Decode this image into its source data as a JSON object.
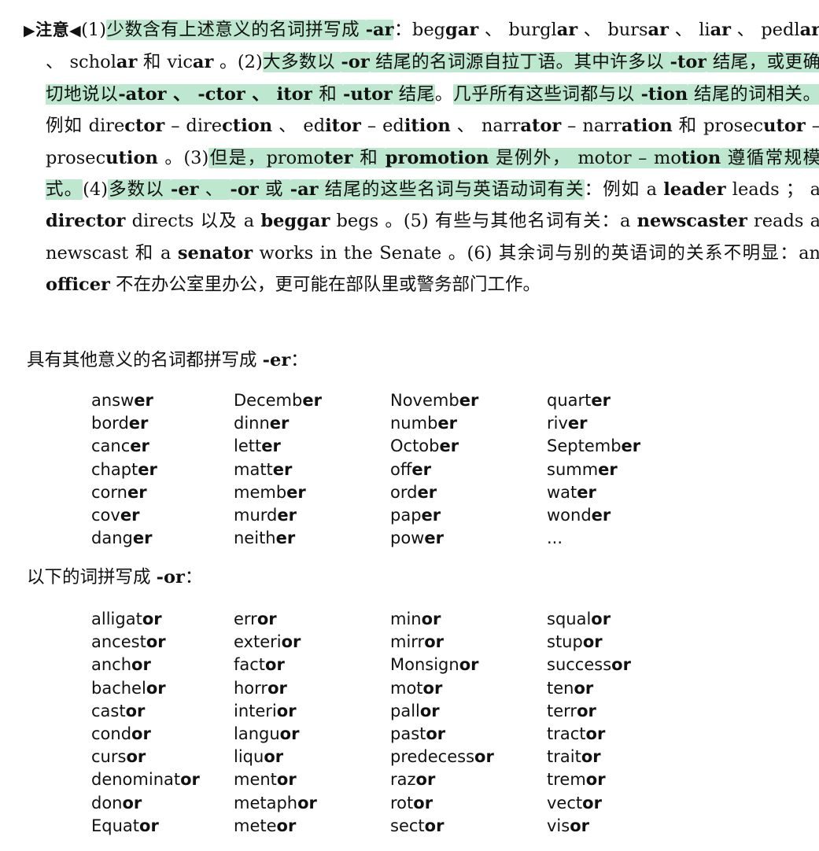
{
  "note": {
    "label": "注意",
    "segments": [
      {
        "text": "(1)",
        "hl": false,
        "bold": false
      },
      {
        "text": "少数含有上述意义的名词拼写成 ",
        "hl": true,
        "bold": false
      },
      {
        "text": "-ar",
        "hl": true,
        "bold": true
      },
      {
        "text": "：beg",
        "hl": false,
        "bold": false
      },
      {
        "text": "gar",
        "hl": false,
        "bold": true
      },
      {
        "text": " 、 burgl",
        "hl": false,
        "bold": false
      },
      {
        "text": "ar",
        "hl": false,
        "bold": true
      },
      {
        "text": " 、 burs",
        "hl": false,
        "bold": false
      },
      {
        "text": "ar",
        "hl": false,
        "bold": true
      },
      {
        "text": " 、 li",
        "hl": false,
        "bold": false
      },
      {
        "text": "ar",
        "hl": false,
        "bold": true
      },
      {
        "text": " 、 pedl",
        "hl": false,
        "bold": false
      },
      {
        "text": "ar",
        "hl": false,
        "bold": true
      },
      {
        "text": " 、 schol",
        "hl": false,
        "bold": false
      },
      {
        "text": "ar",
        "hl": false,
        "bold": true
      },
      {
        "text": " 和 vic",
        "hl": false,
        "bold": false
      },
      {
        "text": "ar",
        "hl": false,
        "bold": true
      },
      {
        "text": " 。(2)",
        "hl": false,
        "bold": false
      },
      {
        "text": "大多数以 ",
        "hl": true,
        "bold": false
      },
      {
        "text": "-or",
        "hl": true,
        "bold": true
      },
      {
        "text": " 结尾的名词源自拉丁语。其中许多以 ",
        "hl": true,
        "bold": false
      },
      {
        "text": "-tor",
        "hl": true,
        "bold": true
      },
      {
        "text": " 结尾，或更确切地说以",
        "hl": true,
        "bold": false
      },
      {
        "text": "-ator 、 -ctor 、 itor",
        "hl": true,
        "bold": true
      },
      {
        "text": " 和 ",
        "hl": true,
        "bold": false
      },
      {
        "text": "-utor",
        "hl": true,
        "bold": true
      },
      {
        "text": " 结尾",
        "hl": true,
        "bold": false
      },
      {
        "text": "。",
        "hl": false,
        "bold": false
      },
      {
        "text": "几乎所有这些词都与以 ",
        "hl": true,
        "bold": false
      },
      {
        "text": "-tion",
        "hl": true,
        "bold": true
      },
      {
        "text": " 结尾的词相关。",
        "hl": true,
        "bold": false
      },
      {
        "text": "例如 dire",
        "hl": false,
        "bold": false
      },
      {
        "text": "ctor",
        "hl": false,
        "bold": true
      },
      {
        "text": " – dire",
        "hl": false,
        "bold": false
      },
      {
        "text": "ction",
        "hl": false,
        "bold": true
      },
      {
        "text": " 、 ed",
        "hl": false,
        "bold": false
      },
      {
        "text": "itor",
        "hl": false,
        "bold": true
      },
      {
        "text": " – ed",
        "hl": false,
        "bold": false
      },
      {
        "text": "ition",
        "hl": false,
        "bold": true
      },
      {
        "text": " 、 narr",
        "hl": false,
        "bold": false
      },
      {
        "text": "ator",
        "hl": false,
        "bold": true
      },
      {
        "text": " – narr",
        "hl": false,
        "bold": false
      },
      {
        "text": "ation",
        "hl": false,
        "bold": true
      },
      {
        "text": " 和 prosec",
        "hl": false,
        "bold": false
      },
      {
        "text": "utor",
        "hl": false,
        "bold": true
      },
      {
        "text": " – prosec",
        "hl": false,
        "bold": false
      },
      {
        "text": "ution",
        "hl": false,
        "bold": true
      },
      {
        "text": " 。(3)",
        "hl": false,
        "bold": false
      },
      {
        "text": "但是，promo",
        "hl": true,
        "bold": false
      },
      {
        "text": "ter",
        "hl": true,
        "bold": true
      },
      {
        "text": " 和 ",
        "hl": true,
        "bold": false
      },
      {
        "text": "promotion",
        "hl": true,
        "bold": true
      },
      {
        "text": " 是例外， motor – mo",
        "hl": true,
        "bold": false
      },
      {
        "text": "tion",
        "hl": true,
        "bold": true
      },
      {
        "text": " 遵循常规模式。",
        "hl": true,
        "bold": false
      },
      {
        "text": "(4)",
        "hl": false,
        "bold": false
      },
      {
        "text": "多数以 ",
        "hl": true,
        "bold": false
      },
      {
        "text": "-er",
        "hl": true,
        "bold": true
      },
      {
        "text": " 、 ",
        "hl": true,
        "bold": false
      },
      {
        "text": "-or",
        "hl": true,
        "bold": true
      },
      {
        "text": " 或 ",
        "hl": true,
        "bold": false
      },
      {
        "text": "-ar",
        "hl": true,
        "bold": true
      },
      {
        "text": " 结尾的这些名词与英语动词有关",
        "hl": true,
        "bold": false
      },
      {
        "text": "：例如 a ",
        "hl": false,
        "bold": false
      },
      {
        "text": "leader",
        "hl": false,
        "bold": true
      },
      {
        "text": " leads ； a ",
        "hl": false,
        "bold": false
      },
      {
        "text": "director",
        "hl": false,
        "bold": true
      },
      {
        "text": " directs 以及 a ",
        "hl": false,
        "bold": false
      },
      {
        "text": "beggar",
        "hl": false,
        "bold": true
      },
      {
        "text": " begs 。(5) 有些与其他名词有关：a ",
        "hl": false,
        "bold": false
      },
      {
        "text": "newscaster",
        "hl": false,
        "bold": true
      },
      {
        "text": " reads a newscast 和 a ",
        "hl": false,
        "bold": false
      },
      {
        "text": "senator",
        "hl": false,
        "bold": true
      },
      {
        "text": " works in the Senate 。(6) 其余词与别的英语词的关系不明显：an ",
        "hl": false,
        "bold": false
      },
      {
        "text": "officer",
        "hl": false,
        "bold": true
      },
      {
        "text": " 不在办公室里办公，更可能在部队里或警务部门工作。",
        "hl": false,
        "bold": false
      }
    ]
  },
  "er_section": {
    "intro": "具有其他意义的名词都拼写成",
    "suffix": "-er",
    "colon": "：",
    "words": [
      [
        "answ",
        "er"
      ],
      [
        "Decemb",
        "er"
      ],
      [
        "Novemb",
        "er"
      ],
      [
        "quart",
        "er"
      ],
      [
        "bord",
        "er"
      ],
      [
        "dinn",
        "er"
      ],
      [
        "numb",
        "er"
      ],
      [
        "riv",
        "er"
      ],
      [
        "canc",
        "er"
      ],
      [
        "lett",
        "er"
      ],
      [
        "Octob",
        "er"
      ],
      [
        "Septemb",
        "er"
      ],
      [
        "chapt",
        "er"
      ],
      [
        "matt",
        "er"
      ],
      [
        "off",
        "er"
      ],
      [
        "summ",
        "er"
      ],
      [
        "corn",
        "er"
      ],
      [
        "memb",
        "er"
      ],
      [
        "ord",
        "er"
      ],
      [
        "wat",
        "er"
      ],
      [
        "cov",
        "er"
      ],
      [
        "murd",
        "er"
      ],
      [
        "pap",
        "er"
      ],
      [
        "wond",
        "er"
      ],
      [
        "dang",
        "er"
      ],
      [
        "neith",
        "er"
      ],
      [
        "pow",
        "er"
      ],
      [
        "...",
        ""
      ]
    ]
  },
  "or_section": {
    "intro": "以下的词拼写成",
    "suffix": "-or",
    "colon": "：",
    "words": [
      [
        "alligat",
        "or"
      ],
      [
        "err",
        "or"
      ],
      [
        "min",
        "or"
      ],
      [
        "squal",
        "or"
      ],
      [
        "ancest",
        "or"
      ],
      [
        "exteri",
        "or"
      ],
      [
        "mirr",
        "or"
      ],
      [
        "stup",
        "or"
      ],
      [
        "anch",
        "or"
      ],
      [
        "fact",
        "or"
      ],
      [
        "Monsign",
        "or"
      ],
      [
        "success",
        "or"
      ],
      [
        "bachel",
        "or"
      ],
      [
        "horr",
        "or"
      ],
      [
        "mot",
        "or"
      ],
      [
        "ten",
        "or"
      ],
      [
        "cast",
        "or"
      ],
      [
        "interi",
        "or"
      ],
      [
        "pall",
        "or"
      ],
      [
        "terr",
        "or"
      ],
      [
        "cond",
        "or"
      ],
      [
        "langu",
        "or"
      ],
      [
        "past",
        "or"
      ],
      [
        "tract",
        "or"
      ],
      [
        "curs",
        "or"
      ],
      [
        "liqu",
        "or"
      ],
      [
        "predecess",
        "or"
      ],
      [
        "trait",
        "or"
      ],
      [
        "denominat",
        "or"
      ],
      [
        "ment",
        "or"
      ],
      [
        "raz",
        "or"
      ],
      [
        "trem",
        "or"
      ],
      [
        "don",
        "or"
      ],
      [
        "metaph",
        "or"
      ],
      [
        "rot",
        "or"
      ],
      [
        "vect",
        "or"
      ],
      [
        "Equat",
        "or"
      ],
      [
        "mete",
        "or"
      ],
      [
        "sect",
        "or"
      ],
      [
        "vis",
        "or"
      ]
    ]
  }
}
